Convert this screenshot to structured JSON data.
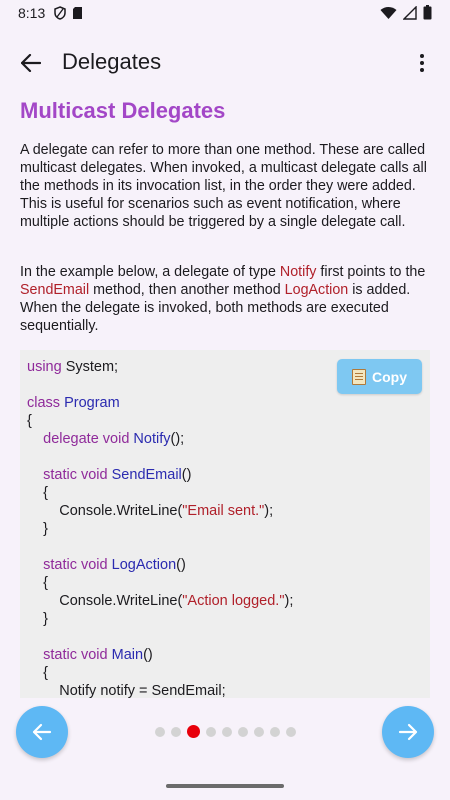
{
  "status_bar": {
    "time": "8:13"
  },
  "app_bar": {
    "title": "Delegates"
  },
  "heading": "Multicast Delegates",
  "paragraph1": "A delegate can refer to more than one method. These are called multicast delegates. When invoked, a multicast delegate calls all the methods in its invocation list, in the order they were added. This is useful for scenarios such as event notification, where multiple actions should be triggered by a single delegate call.",
  "paragraph2": {
    "part1": "In the example below, a delegate of type ",
    "hl1": "Notify",
    "part2": " first points to the ",
    "hl2": "SendEmail",
    "part3": " method, then another method ",
    "hl3": "LogAction",
    "part4": " is added. When the delegate is invoked, both methods are executed sequentially."
  },
  "code": {
    "l1_kw": "using",
    "l1_rest": " System;",
    "l3_kw": "class",
    "l3_type": "Program",
    "l4": "{",
    "l5_kw": "delegate void",
    "l5_type": "Notify",
    "l5_rest": "();",
    "l7_kw": "static void",
    "l7_type": "SendEmail",
    "l7_rest": "()",
    "l8": "{",
    "l9_pre": "Console.WriteLine(",
    "l9_str": "\"Email sent.\"",
    "l9_post": ");",
    "l10": "}",
    "l12_kw": "static void",
    "l12_type": "LogAction",
    "l12_rest": "()",
    "l13": "{",
    "l14_pre": "Console.WriteLine(",
    "l14_str": "\"Action logged.\"",
    "l14_post": ");",
    "l15": "}",
    "l17_kw": "static void",
    "l17_type": "Main",
    "l17_rest": "()",
    "l18": "{",
    "l19": "Notify notify = SendEmail;"
  },
  "copy_button": {
    "label": "Copy"
  },
  "pagination": {
    "total": 9,
    "current": 3
  },
  "colors": {
    "accent": "#a347c7",
    "nav_button": "#5eb8f4",
    "active_dot": "#e8000b",
    "highlight": "#b0202a"
  }
}
